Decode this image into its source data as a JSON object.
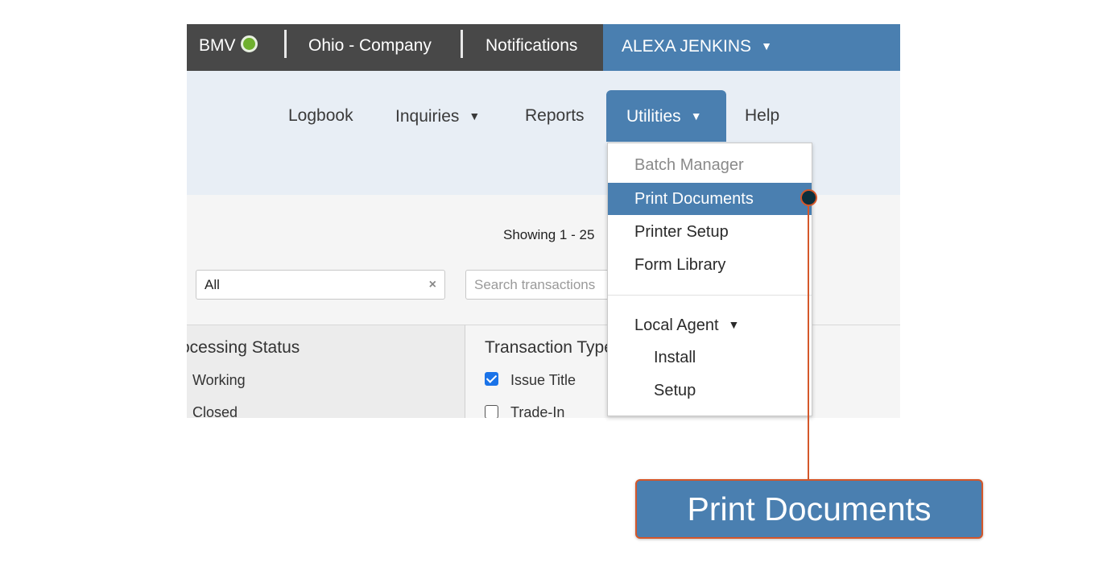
{
  "topbar": {
    "bmv_label": "BMV",
    "company": "Ohio - Company",
    "notifications": "Notifications",
    "user_name": "ALEXA JENKINS",
    "caret": "▼",
    "status_color": "#6fb02e"
  },
  "nav": {
    "logbook": "Logbook",
    "inquiries": "Inquiries",
    "reports": "Reports",
    "utilities": "Utilities",
    "help": "Help",
    "caret": "▼"
  },
  "content": {
    "showing_text": "Showing 1 - 25",
    "filter_value": "All",
    "filter_clear": "×",
    "search_placeholder": "Search transactions"
  },
  "filters": {
    "processing_title": "ocessing Status",
    "working": "Working",
    "closed": "Closed",
    "type_title": "Transaction Type",
    "issue_title": "Issue Title",
    "trade_in": "Trade-In",
    "issue_title_checked": true,
    "trade_in_checked": false
  },
  "utilities_menu": {
    "batch_manager": "Batch Manager",
    "print_documents": "Print Documents",
    "printer_setup": "Printer Setup",
    "form_library": "Form Library",
    "local_agent": "Local Agent",
    "install": "Install",
    "setup": "Setup",
    "caret": "▼"
  },
  "callout": {
    "label": "Print Documents",
    "accent": "#d4572a"
  },
  "colors": {
    "brand_blue": "#4a7fb0",
    "topbar_dark": "#484848",
    "nav_bg": "#e8eef5"
  }
}
